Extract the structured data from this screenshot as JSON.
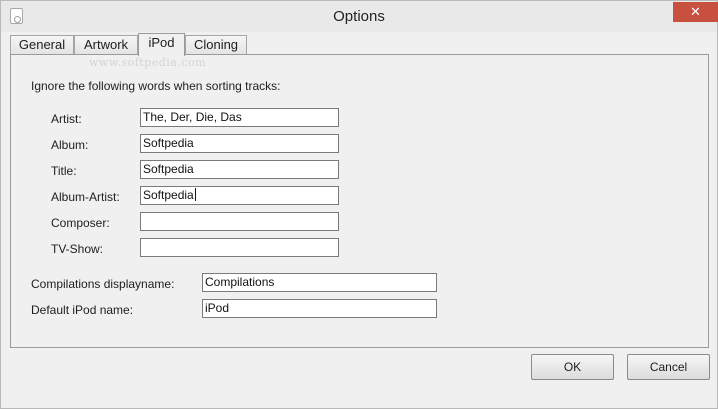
{
  "window": {
    "title": "Options",
    "close_symbol": "✕",
    "icon": "app-document-icon"
  },
  "tabs": [
    {
      "label": "General",
      "active": false
    },
    {
      "label": "Artwork",
      "active": false
    },
    {
      "label": "iPod",
      "active": true
    },
    {
      "label": "Cloning",
      "active": false
    }
  ],
  "watermark": "www.softpedia.com",
  "ipod_tab": {
    "instruction": "Ignore the following words when sorting tracks:",
    "fields": [
      {
        "label": "Artist:",
        "value": "The, Der, Die, Das"
      },
      {
        "label": "Album:",
        "value": "Softpedia"
      },
      {
        "label": "Title:",
        "value": "Softpedia"
      },
      {
        "label": "Album-Artist:",
        "value": "Softpedia"
      },
      {
        "label": "Composer:",
        "value": ""
      },
      {
        "label": "TV-Show:",
        "value": ""
      }
    ],
    "compilations_label": "Compilations displayname:",
    "compilations_value": "Compilations",
    "default_ipod_label": "Default iPod name:",
    "default_ipod_value": "iPod"
  },
  "buttons": {
    "ok": "OK",
    "cancel": "Cancel"
  },
  "colors": {
    "close_button": "#c7503f",
    "window_background": "#f0f0f0"
  }
}
